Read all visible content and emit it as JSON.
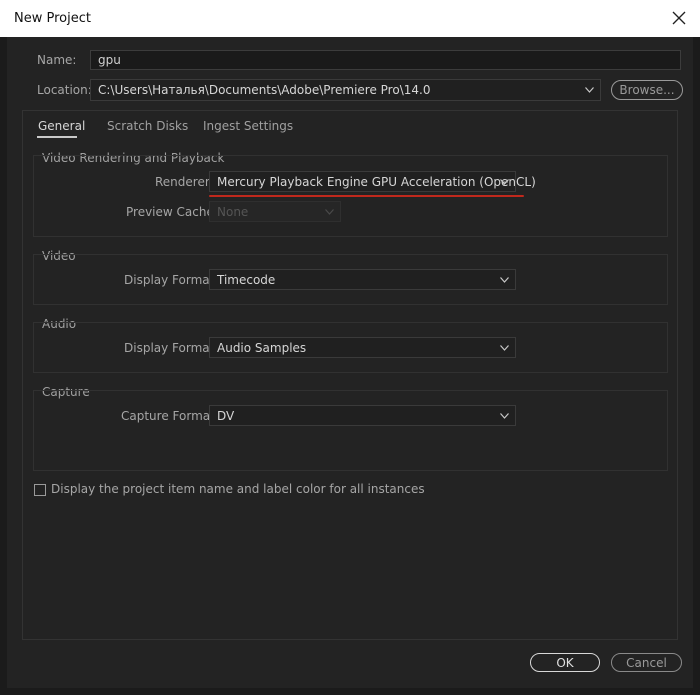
{
  "window": {
    "title": "New Project",
    "close_icon": "close-icon"
  },
  "form": {
    "name_label": "Name:",
    "name_value": "gpu",
    "location_label": "Location:",
    "location_value": "C:\\Users\\Наталья\\Documents\\Adobe\\Premiere Pro\\14.0",
    "browse_label": "Browse..."
  },
  "tabs": [
    {
      "label": "General",
      "active": true
    },
    {
      "label": "Scratch Disks",
      "active": false
    },
    {
      "label": "Ingest Settings",
      "active": false
    }
  ],
  "video_rendering": {
    "title": "Video Rendering and Playback",
    "renderer_label": "Renderer:",
    "renderer_value": "Mercury Playback Engine GPU Acceleration (OpenCL)",
    "preview_cache_label": "Preview Cache:",
    "preview_cache_value": "None",
    "highlight_color": "#c0281c"
  },
  "video": {
    "title": "Video",
    "display_format_label": "Display Format:",
    "display_format_value": "Timecode"
  },
  "audio": {
    "title": "Audio",
    "display_format_label": "Display Format:",
    "display_format_value": "Audio Samples"
  },
  "capture": {
    "title": "Capture",
    "capture_format_label": "Capture Format:",
    "capture_format_value": "DV"
  },
  "checkbox": {
    "label": "Display the project item name and label color for all instances",
    "checked": false
  },
  "buttons": {
    "ok": "OK",
    "cancel": "Cancel"
  }
}
